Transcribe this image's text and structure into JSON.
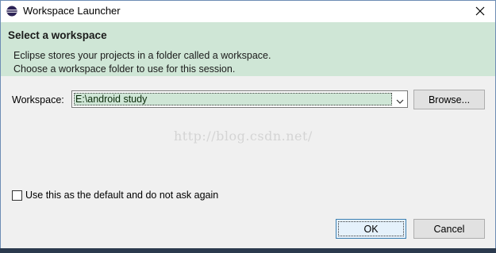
{
  "window": {
    "title": "Workspace Launcher",
    "icons": {
      "app": "eclipse-icon",
      "close": "close-icon"
    }
  },
  "banner": {
    "title": "Select a workspace",
    "line1": "Eclipse stores your projects in a folder called a workspace.",
    "line2": "Choose a workspace folder to use for this session."
  },
  "workspace": {
    "label": "Workspace:",
    "value": "E:\\android study",
    "browse_label": "Browse..."
  },
  "watermark": "http://blog.csdn.net/",
  "default_option": {
    "label": "Use this as the default and do not ask again",
    "checked": false
  },
  "buttons": {
    "ok": "OK",
    "cancel": "Cancel"
  },
  "colors": {
    "banner": "#cfe6d6",
    "selection": "#cfe6d6",
    "ok_border": "#3c7fb1"
  }
}
